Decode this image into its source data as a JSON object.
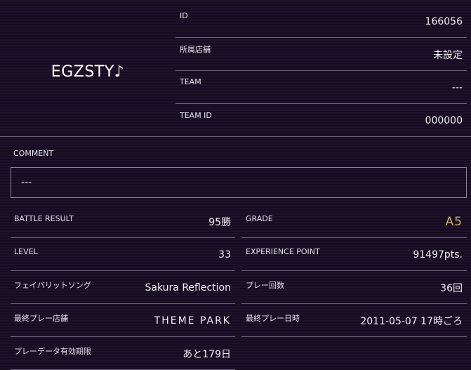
{
  "player": {
    "name": "EGZSTY♪"
  },
  "profile": {
    "id_label": "ID",
    "id_value": "166056",
    "shop_label": "所属店舗",
    "shop_value": "未設定",
    "team_label": "TEAM",
    "team_value": "---",
    "team_id_label": "TEAM ID",
    "team_id_value": "000000"
  },
  "comment": {
    "label": "COMMENT",
    "value": "---"
  },
  "stats": {
    "battle_result_label": "BATTLE RESULT",
    "battle_result_value": "95勝",
    "grade_label": "GRADE",
    "grade_value": "A5",
    "level_label": "LEVEL",
    "level_value": "33",
    "exp_label": "EXPERIENCE POINT",
    "exp_value": "91497pts.",
    "favorite_song_label": "フェイバリットソング",
    "favorite_song_value": "Sakura Reflection",
    "play_count_label": "プレー回数",
    "play_count_value": "36回",
    "last_shop_label": "最終プレー店舗",
    "last_shop_value": "THEME PARK",
    "last_play_label": "最終プレー日時",
    "last_play_value": "2011-05-07 17時ごろ",
    "expiry_label": "プレーデータ有効期限",
    "expiry_value": "あと179日"
  },
  "colors": {
    "background": "#1b1026",
    "grade": "#c9b36a",
    "divider": "#6a6078"
  }
}
